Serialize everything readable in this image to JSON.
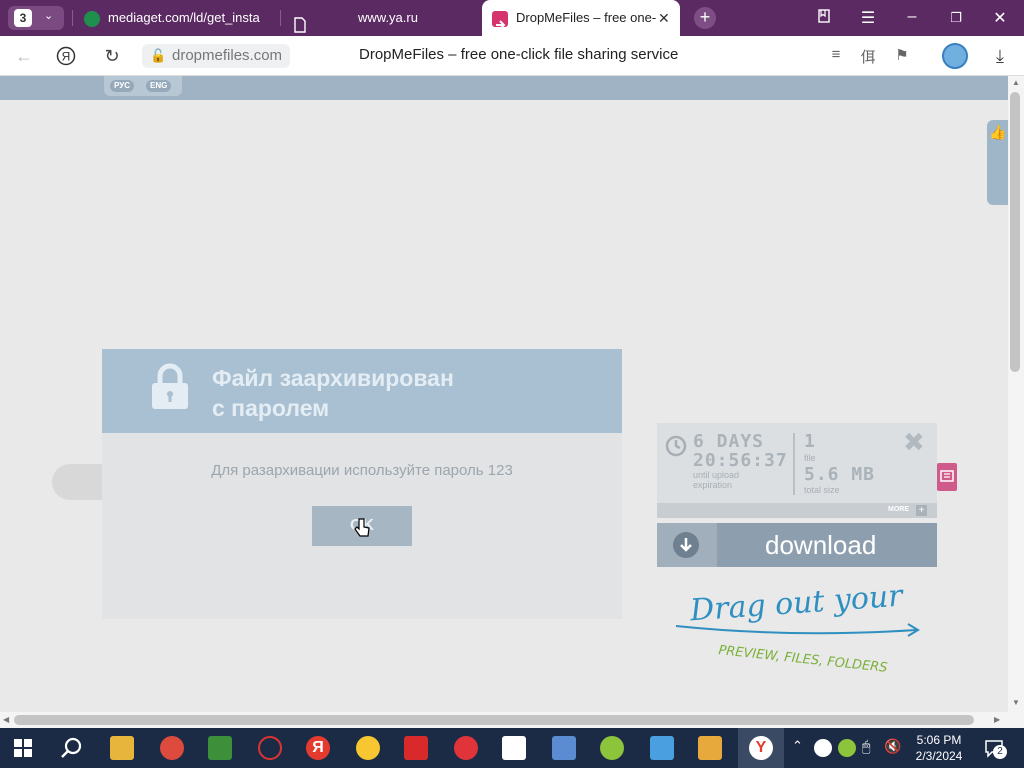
{
  "browser": {
    "tab_count": "3",
    "tabs": [
      {
        "label": "mediaget.com/ld/get_insta"
      },
      {
        "label": "www.ya.ru"
      },
      {
        "label": "DropMeFiles – free one-"
      }
    ],
    "url": "dropmefiles.com",
    "page_title": "DropMeFiles – free one-click file sharing service"
  },
  "page": {
    "lang": {
      "ru": "РУС",
      "en": "ENG"
    },
    "modal": {
      "title_line1": "Файл заархивирован",
      "title_line2": "с паролем",
      "message": "Для разархивации используйте пароль 123",
      "ok_label": "OK"
    },
    "info": {
      "days": "6 DAYS",
      "time": "20:56:37",
      "expiration_label_1": "until upload",
      "expiration_label_2": "expiration",
      "file_count": "1",
      "file_label": "file",
      "size": "5.6 MB",
      "size_label": "total size",
      "more_label": "MORE"
    },
    "download_label": "download",
    "drag_text": "Drag out your",
    "drag_sub": "PREVIEW, FILES, FOLDERS"
  },
  "taskbar": {
    "time": "5:06 PM",
    "date": "2/3/2024",
    "notifications": "2"
  },
  "colors": {
    "tabbar": "#5c2a63",
    "accent_blue": "#a9c0d2",
    "download": "#8d9fae",
    "taskbar": "#1b2b46"
  }
}
